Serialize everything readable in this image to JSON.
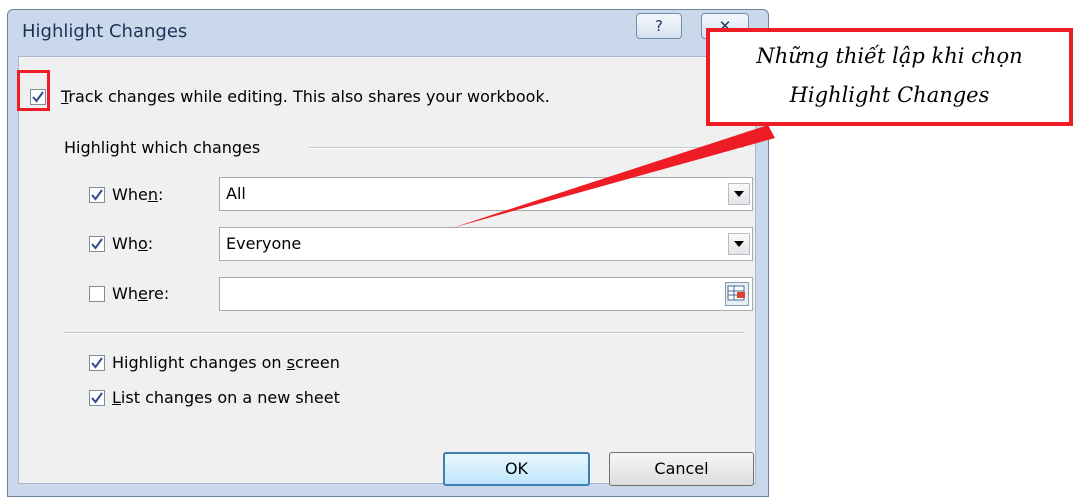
{
  "dialog": {
    "title": "Highlight Changes",
    "help_label": "?",
    "close_label": "✕"
  },
  "track": {
    "label_underline": "T",
    "label_rest": "rack changes while editing. This also shares your workbook.",
    "checked": true
  },
  "group": {
    "label": "Highlight which changes"
  },
  "when": {
    "pre": "Whe",
    "ul": "n",
    "post": ":",
    "value": "All",
    "checked": true
  },
  "who": {
    "pre": "Wh",
    "ul": "o",
    "post": ":",
    "value": "Everyone",
    "checked": true
  },
  "where": {
    "pre": "Wh",
    "ul": "e",
    "post": "re:",
    "value": "",
    "checked": false
  },
  "screen": {
    "pre": "Highlight changes on ",
    "ul": "s",
    "post": "creen",
    "checked": true
  },
  "sheet": {
    "pre": "",
    "ul": "L",
    "post": "ist changes on a new sheet",
    "checked": true
  },
  "buttons": {
    "ok": "OK",
    "cancel": "Cancel"
  },
  "annotation": {
    "line1": "Những thiết lập khi chọn",
    "line2": "Highlight Changes",
    "accent": "#ee1c25"
  }
}
